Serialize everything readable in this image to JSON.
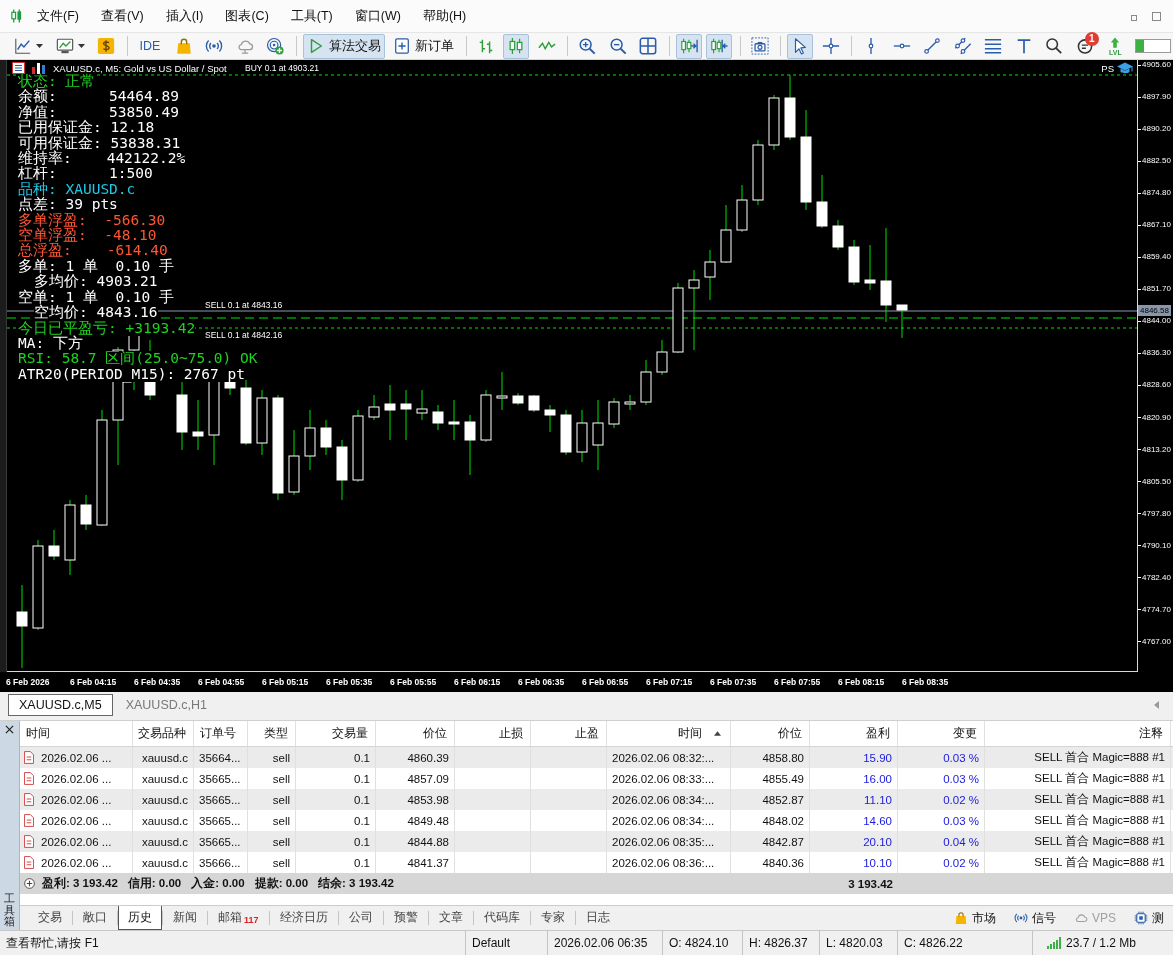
{
  "menubar": {
    "items": [
      "文件(F)",
      "查看(V)",
      "插入(I)",
      "图表(C)",
      "工具(T)",
      "窗口(W)",
      "帮助(H)"
    ]
  },
  "toolbar": {
    "groups": [
      {
        "buttons": [
          {
            "pressed": false
          },
          {
            "pressed": false
          },
          {
            "pressed": false
          }
        ]
      },
      {
        "buttons": [
          {
            "label": "IDE",
            "pressed": false
          },
          {
            "pressed": false
          },
          {
            "pressed": false
          },
          {
            "pressed": false
          },
          {
            "pressed": false
          }
        ]
      },
      {
        "buttons": [
          {
            "label": "算法交易",
            "pressed": true
          },
          {
            "label": "新订单",
            "pressed": false
          }
        ]
      },
      {
        "buttons": [
          {
            "pressed": false
          },
          {
            "pressed": true
          },
          {
            "pressed": false
          }
        ]
      },
      {
        "buttons": [
          {
            "pressed": false
          },
          {
            "pressed": false
          },
          {
            "pressed": false
          }
        ]
      },
      {
        "buttons": [
          {
            "pressed": true
          },
          {
            "pressed": true
          }
        ]
      },
      {
        "buttons": [
          {
            "pressed": false
          }
        ]
      },
      {
        "buttons": [
          {
            "pressed": true
          },
          {
            "pressed": false
          }
        ]
      },
      {
        "buttons": [
          {
            "pressed": false
          },
          {
            "pressed": false
          },
          {
            "pressed": false
          },
          {
            "pressed": false
          },
          {
            "pressed": false
          },
          {
            "pressed": false
          },
          {
            "pressed": false
          },
          {
            "pressed": false,
            "badge": "1"
          },
          {
            "label": "LVL",
            "pressed": false
          }
        ]
      }
    ],
    "meter": {
      "level": 0.25
    }
  },
  "chart": {
    "title": "XAUUSD.c, M5: Gold vs US Dollar / Spot",
    "corner_label": "PS",
    "order_labels": [
      "BUY 0.1 at 4903.21",
      "SELL 0.1 at 4843.16",
      "SELL 0.1 at 4842.16"
    ],
    "info_lines": [
      {
        "text": "状态: 正常",
        "color": "#1ed21e"
      },
      {
        "text": "余额:      54464.89",
        "color": "#ffffff"
      },
      {
        "text": "净值:      53850.49",
        "color": "#ffffff"
      },
      {
        "text": "已用保证金: 12.18",
        "color": "#ffffff"
      },
      {
        "text": "可用保证金: 53838.31",
        "color": "#ffffff"
      },
      {
        "text": "维持率:    442122.2%",
        "color": "#ffffff"
      },
      {
        "text": "杠杆:      1:500",
        "color": "#ffffff"
      },
      {
        "text": "品种: XAUUSD.c",
        "color": "#1ec8e6"
      },
      {
        "text": "点差: 39 pts",
        "color": "#ffffff"
      },
      {
        "text": "多单浮盈:  -566.30",
        "color": "#ff5533"
      },
      {
        "text": "空单浮盈:  -48.10",
        "color": "#ff5533"
      },
      {
        "text": "总浮盈:    -614.40",
        "color": "#ff5533"
      },
      {
        "text": "多单: 1 单  0.10 手",
        "color": "#ffffff",
        "children": [
          {
            "text": "多均价: 4903.21",
            "color": "#ffffff"
          }
        ]
      },
      {
        "text": "空单: 1 单  0.10 手",
        "color": "#ffffff",
        "children": [
          {
            "text": "空均价: 4843.16",
            "color": "#ffffff"
          }
        ]
      },
      {
        "text": "今日已平盈亏: +3193.42",
        "color": "#1ed21e"
      },
      {
        "text": "MA: 下方",
        "color": "#ffffff"
      },
      {
        "text": "RSI: 58.7 区间(25.0~75.0) OK",
        "color": "#1ed21e"
      },
      {
        "text": "ATR20(PERIOD_M15): 2767 pt",
        "color": "#ffffff"
      }
    ],
    "current_price": "4846.58",
    "price_axis": [
      "4905.60",
      "4897.90",
      "4890.20",
      "4882.50",
      "4874.80",
      "4867.10",
      "4859.40",
      "4851.70",
      "4844.00",
      "4836.30",
      "4828.60",
      "4820.90",
      "4813.20",
      "4805.50",
      "4797.80",
      "4790.10",
      "4782.40",
      "4774.70",
      "4767.00"
    ],
    "time_axis": [
      "6 Feb 2026",
      "6 Feb 04:15",
      "6 Feb 04:35",
      "6 Feb 04:55",
      "6 Feb 05:15",
      "6 Feb 05:35",
      "6 Feb 05:55",
      "6 Feb 06:15",
      "6 Feb 06:35",
      "6 Feb 06:55",
      "6 Feb 07:15",
      "6 Feb 07:35",
      "6 Feb 07:55",
      "6 Feb 08:15",
      "6 Feb 08:35"
    ]
  },
  "chart_tabs": [
    {
      "label": "XAUUSD.c,M5",
      "selected": true
    },
    {
      "label": "XAUUSD.c,H1",
      "selected": false
    }
  ],
  "terminal": {
    "title": "工具箱",
    "columns": [
      {
        "label": "时间",
        "sorted": false
      },
      {
        "label": "交易品种",
        "sorted": false
      },
      {
        "label": "订单号",
        "sorted": false
      },
      {
        "label": "类型",
        "sorted": false
      },
      {
        "label": "交易量",
        "sorted": false
      },
      {
        "label": "价位",
        "sorted": false
      },
      {
        "label": "止损",
        "sorted": false
      },
      {
        "label": "止盈",
        "sorted": false
      },
      {
        "label": "时间",
        "sorted": true
      },
      {
        "label": "价位",
        "sorted": false
      },
      {
        "label": "盈利",
        "sorted": false
      },
      {
        "label": "变更",
        "sorted": false
      },
      {
        "label": "注释",
        "sorted": false
      }
    ],
    "rows": [
      {
        "open_time": "2026.02.06 ...",
        "symbol": "xauusd.c",
        "ticket": "35664...",
        "type": "sell",
        "volume": "0.1",
        "open_price": "4860.39",
        "close_time": "2026.02.06 08:32:...",
        "close_price": "4858.80",
        "profit": "15.90",
        "change": "0.03 %",
        "comment": "SELL 首合 Magic=888 #1"
      },
      {
        "open_time": "2026.02.06 ...",
        "symbol": "xauusd.c",
        "ticket": "35665...",
        "type": "sell",
        "volume": "0.1",
        "open_price": "4857.09",
        "close_time": "2026.02.06 08:33:...",
        "close_price": "4855.49",
        "profit": "16.00",
        "change": "0.03 %",
        "comment": "SELL 首合 Magic=888 #1"
      },
      {
        "open_time": "2026.02.06 ...",
        "symbol": "xauusd.c",
        "ticket": "35665...",
        "type": "sell",
        "volume": "0.1",
        "open_price": "4853.98",
        "close_time": "2026.02.06 08:34:...",
        "close_price": "4852.87",
        "profit": "11.10",
        "change": "0.02 %",
        "comment": "SELL 首合 Magic=888 #1"
      },
      {
        "open_time": "2026.02.06 ...",
        "symbol": "xauusd.c",
        "ticket": "35665...",
        "type": "sell",
        "volume": "0.1",
        "open_price": "4849.48",
        "close_time": "2026.02.06 08:34:...",
        "close_price": "4848.02",
        "profit": "14.60",
        "change": "0.03 %",
        "comment": "SELL 首合 Magic=888 #1"
      },
      {
        "open_time": "2026.02.06 ...",
        "symbol": "xauusd.c",
        "ticket": "35665...",
        "type": "sell",
        "volume": "0.1",
        "open_price": "4844.88",
        "close_time": "2026.02.06 08:35:...",
        "close_price": "4842.87",
        "profit": "20.10",
        "change": "0.04 %",
        "comment": "SELL 首合 Magic=888 #1"
      },
      {
        "open_time": "2026.02.06 ...",
        "symbol": "xauusd.c",
        "ticket": "35666...",
        "type": "sell",
        "volume": "0.1",
        "open_price": "4841.37",
        "close_time": "2026.02.06 08:36:...",
        "close_price": "4840.36",
        "profit": "10.10",
        "change": "0.02 %",
        "comment": "SELL 首合 Magic=888 #1"
      }
    ],
    "summary": {
      "items": [
        "盈利: 3 193.42",
        "信用: 0.00",
        "入金: 0.00",
        "提款: 0.00",
        "结余: 3 193.42"
      ],
      "profit_total": "3 193.42"
    },
    "tabs": [
      {
        "label": "交易",
        "selected": false
      },
      {
        "label": "敞口",
        "selected": false
      },
      {
        "label": "历史",
        "selected": true
      },
      {
        "label": "新闻",
        "selected": false
      },
      {
        "label": "邮箱",
        "selected": false,
        "badge": "117"
      },
      {
        "label": "经济日历",
        "selected": false
      },
      {
        "label": "公司",
        "selected": false
      },
      {
        "label": "预警",
        "selected": false
      },
      {
        "label": "文章",
        "selected": false
      },
      {
        "label": "代码库",
        "selected": false
      },
      {
        "label": "专家",
        "selected": false
      },
      {
        "label": "日志",
        "selected": false
      }
    ],
    "side_tabs": [
      {
        "label": "市场",
        "disabled": false
      },
      {
        "label": "信号",
        "disabled": false
      },
      {
        "label": "VPS",
        "disabled": true
      },
      {
        "label": "测",
        "disabled": false
      }
    ]
  },
  "status_bar": {
    "help": "查看帮忙,请按 F1",
    "profile": "Default",
    "datetime": "2026.02.06 06:35",
    "open": "O: 4824.10",
    "high": "H: 4826.37",
    "low": "L: 4820.03",
    "close": "C: 4826.22",
    "traffic": "23.7 / 1.2 Mb"
  }
}
